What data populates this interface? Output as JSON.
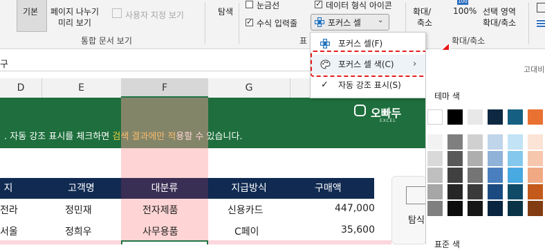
{
  "ribbon": {
    "normal_view": "기본",
    "page_break_line1": "페이지 나누기",
    "page_break_line2": "미리 보기",
    "custom_view": "사용자 지정 보기",
    "group_workbook_views": "통합 문서 보기",
    "navigation": "탐색",
    "gridlines": "눈금선",
    "formula_bar": "수식 입력줄",
    "data_format_icons": "데이터 형식 아이콘",
    "focus_cell": "포커스 셀",
    "show_group_partial": "표",
    "zoom_line1": "확대/",
    "zoom_line2": "축소",
    "zoom_100": "100%",
    "zoom_selection_line1": "선택 영역",
    "zoom_selection_line2": "확대/축소",
    "group_zoom": "확대/축소"
  },
  "formula_bar": {
    "partial_text": "구"
  },
  "columns": [
    "D",
    "E",
    "F",
    "G"
  ],
  "banner": {
    "brand": "오빠두",
    "brand_sub": "EXCEL",
    "text_before": ". 자동 강조 표시를 체크하면 ",
    "text_highlight": "검색 결과에만 적",
    "text_after": "용할 수 있습니다."
  },
  "table": {
    "headers": [
      "지역",
      "고객명",
      "대분류",
      "지급방식",
      "구매액"
    ],
    "rows": [
      [
        "전라",
        "정민재",
        "전자제품",
        "신용카드",
        "447,000"
      ],
      [
        "서울",
        "정희우",
        "사무용품",
        "C페이",
        "35,600"
      ]
    ]
  },
  "menu": {
    "items": [
      {
        "label": "포커스 셀(F)"
      },
      {
        "label": "포커스 셀 색(C)"
      },
      {
        "label": "자동 강조 표시(S)"
      }
    ]
  },
  "color_panel": {
    "title_partial": "고대비",
    "theme_colors": "테마 색",
    "standard_colors": "표준 색"
  },
  "side_button": {
    "label_partial": "탐식"
  },
  "colors": {
    "banner": "#1e6f3d",
    "header": "#102a52",
    "highlight": "#ffa0a0",
    "annotation": "#e51c1c"
  }
}
